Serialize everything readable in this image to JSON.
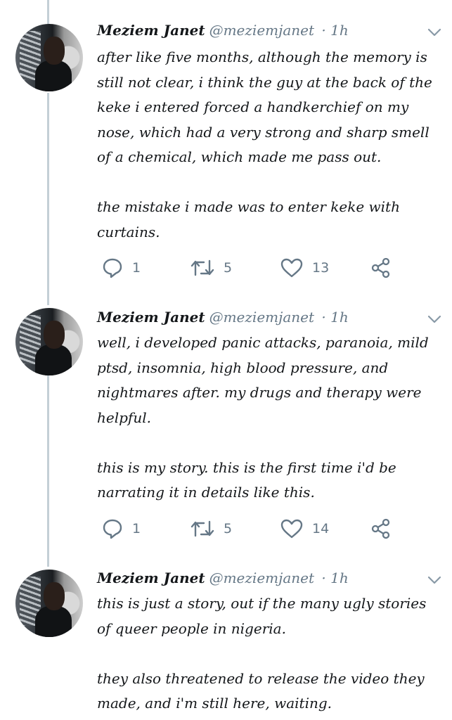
{
  "tweets": [
    {
      "name": "Meziem Janet",
      "handle": "@meziemjanet",
      "time": "· 1h",
      "text": "after like five months, although the memory is\nstill not clear, i think the guy at the back of the\nkeke i entered forced a handkerchief on my\nnose, which had a very strong and sharp smell\nof a chemical, which made me pass out.\n\nthe mistake i made was to enter keke with\ncurtains.",
      "replies": "1",
      "retweets": "5",
      "likes": "13"
    },
    {
      "name": "Meziem Janet",
      "handle": "@meziemjanet",
      "time": "· 1h",
      "text": "well, i developed panic attacks, paranoia, mild\nptsd, insomnia, high blood pressure, and\nnightmares after. my drugs and therapy were\nhelpful.\n\nthis is my story. this is the first time i'd be\nnarrating it in details like this.",
      "replies": "1",
      "retweets": "5",
      "likes": "14"
    },
    {
      "name": "Meziem Janet",
      "handle": "@meziemjanet",
      "time": "· 1h",
      "text": "this is just a story, out if the many ugly stories\nof queer people in nigeria.\n\nthey also threatened to release the video they\nmade, and i'm still here, waiting.",
      "replies": "",
      "retweets": "",
      "likes": ""
    }
  ],
  "icons": {
    "reply": "reply-icon",
    "retweet": "retweet-icon",
    "like": "heart-icon",
    "share": "share-icon",
    "menu": "chevron-down-icon"
  },
  "colors": {
    "text": "#14171a",
    "secondary": "#657786",
    "thread_line": "#c4cfd6"
  }
}
